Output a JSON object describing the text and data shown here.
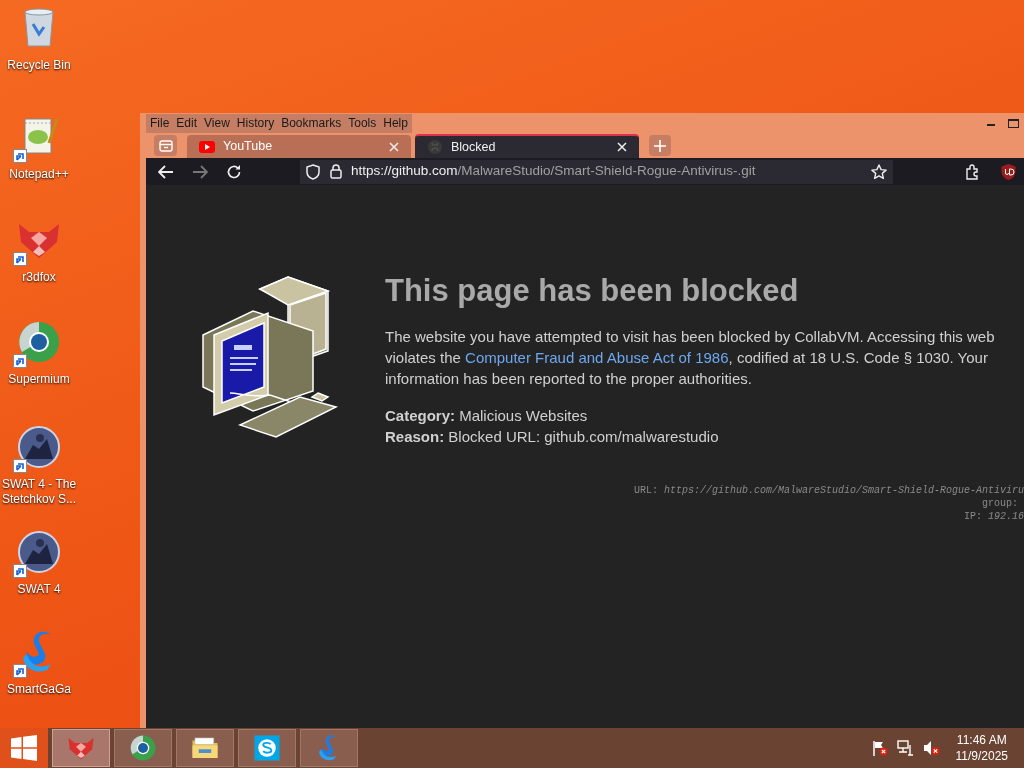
{
  "desktop_icons": [
    {
      "kind": "recycle",
      "label": "Recycle Bin",
      "shortcut": false
    },
    {
      "kind": "notepad",
      "label": "Notepad++",
      "shortcut": true
    },
    {
      "kind": "r3dfox",
      "label": "r3dfox",
      "shortcut": true
    },
    {
      "kind": "supermium",
      "label": "Supermium",
      "shortcut": true
    },
    {
      "kind": "swat",
      "label": "SWAT 4 - The Stetchkov S...",
      "shortcut": true
    },
    {
      "kind": "swat",
      "label": "SWAT 4",
      "shortcut": true
    },
    {
      "kind": "smartgaga",
      "label": "SmartGaGa",
      "shortcut": true
    }
  ],
  "browser": {
    "menu": [
      "File",
      "Edit",
      "View",
      "History",
      "Bookmarks",
      "Tools",
      "Help"
    ],
    "tabs": [
      {
        "kind": "youtube",
        "title": "YouTube",
        "selected": false
      },
      {
        "kind": "github",
        "title": "Blocked",
        "selected": true
      }
    ],
    "toolbar": {
      "back_disabled": false,
      "forward_disabled": true
    },
    "url": {
      "host": "https://github.com",
      "path": "/MalwareStudio/Smart-Shield-Rogue-Antivirus-.git"
    },
    "page": {
      "heading": "This page has been blocked",
      "line_1": "The website you have attempted to visit has been blocked by CollabVM. Accessing this web",
      "line_2_before": "violates the ",
      "link": "Computer Fraud and Abuse Act of 1986",
      "line_2_after": ", codified at 18 U.S. Code § 1030. Your",
      "line_3": "information has been reported to the proper authorities.",
      "details": [
        {
          "label": "Category:",
          "value": "Malicious Websites"
        },
        {
          "label": "Reason:",
          "value": "Blocked URL: github.com/malwarestudio"
        }
      ],
      "debug": [
        "URL: *https://github.com/MalwareStudio/Smart-Shield-Rogue-Antiviru*",
        "group: ",
        "IP: *192.16*"
      ]
    }
  },
  "taskbar": {
    "items": [
      {
        "kind": "r3dfox",
        "selected": true
      },
      {
        "kind": "supermium",
        "selected": false
      },
      {
        "kind": "explorer",
        "selected": false
      },
      {
        "kind": "skype",
        "selected": false
      },
      {
        "kind": "smartgaga",
        "selected": false
      }
    ],
    "time": "11:46 AM",
    "date": "11/9/2025"
  }
}
